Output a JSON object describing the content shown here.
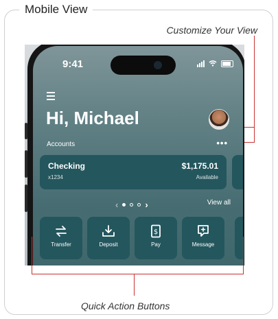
{
  "frame": {
    "title": "Mobile View"
  },
  "annotations": {
    "customize": "Customize Your View",
    "quick_actions": "Quick Action Buttons"
  },
  "status_bar": {
    "time": "9:41"
  },
  "header": {
    "greeting": "Hi, Michael",
    "menu_icon": "hamburger-menu-icon",
    "avatar_icon": "user-avatar"
  },
  "accounts": {
    "label": "Accounts",
    "more_icon": "more-dots-icon",
    "card": {
      "name": "Checking",
      "number": "x1234",
      "balance": "$1,175.01",
      "status": "Available"
    },
    "pager": {
      "view_all": "View all"
    }
  },
  "quick_actions": [
    {
      "label": "Transfer",
      "icon": "transfer-icon"
    },
    {
      "label": "Deposit",
      "icon": "deposit-icon"
    },
    {
      "label": "Pay",
      "icon": "pay-icon"
    },
    {
      "label": "Message",
      "icon": "message-icon"
    }
  ],
  "colors": {
    "accent_line": "#c92f2f",
    "card_teal": "#24565d"
  }
}
